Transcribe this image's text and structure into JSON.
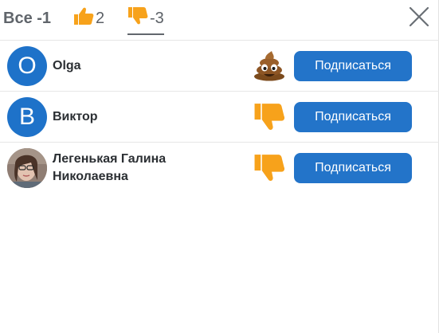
{
  "tabs": {
    "all_label": "Все -1",
    "likes_count": "2",
    "dislikes_count": "-3"
  },
  "users": [
    {
      "name": "Olga",
      "avatar_letter": "O",
      "reaction": "poop-emoji-icon"
    },
    {
      "name": "Виктор",
      "avatar_letter": "В",
      "reaction": "thumbs-down-icon"
    },
    {
      "name": "Легенькая Галина Николаевна",
      "avatar_letter": "",
      "reaction": "thumbs-down-icon"
    }
  ],
  "subscribe_label": "Подписаться",
  "colors": {
    "accent": "#2374c9",
    "avatar": "#1e72c9",
    "thumb": "#f7a21b"
  }
}
